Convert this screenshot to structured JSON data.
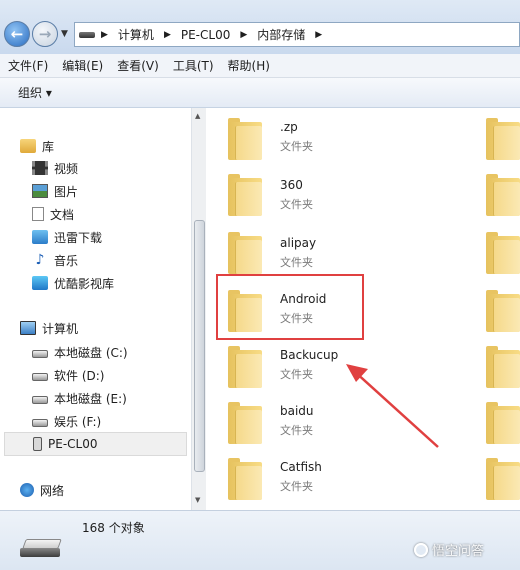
{
  "breadcrumb": [
    "计算机",
    "PE-CL00",
    "内部存储"
  ],
  "menu": [
    "文件(F)",
    "编辑(E)",
    "查看(V)",
    "工具(T)",
    "帮助(H)"
  ],
  "toolbar": {
    "organize": "组织 ▾"
  },
  "nav": {
    "library": "库",
    "libraries": [
      "视频",
      "图片",
      "文档",
      "迅雷下载",
      "音乐",
      "优酷影视库"
    ],
    "computer": "计算机",
    "drives": [
      "本地磁盘 (C:)",
      "软件 (D:)",
      "本地磁盘 (E:)",
      "娱乐 (F:)",
      "PE-CL00"
    ],
    "network": "网络"
  },
  "folders": [
    {
      "name": ".zp",
      "type": "文件夹"
    },
    {
      "name": "360",
      "type": "文件夹"
    },
    {
      "name": "alipay",
      "type": "文件夹"
    },
    {
      "name": "Android",
      "type": "文件夹"
    },
    {
      "name": "Backucup",
      "type": "文件夹"
    },
    {
      "name": "baidu",
      "type": "文件夹"
    },
    {
      "name": "Catfish",
      "type": "文件夹"
    }
  ],
  "status": {
    "count": "168 个对象"
  },
  "watermark": "悟空问答",
  "colors": {
    "highlight": "#e04040",
    "accent": "#2a6cc0"
  }
}
